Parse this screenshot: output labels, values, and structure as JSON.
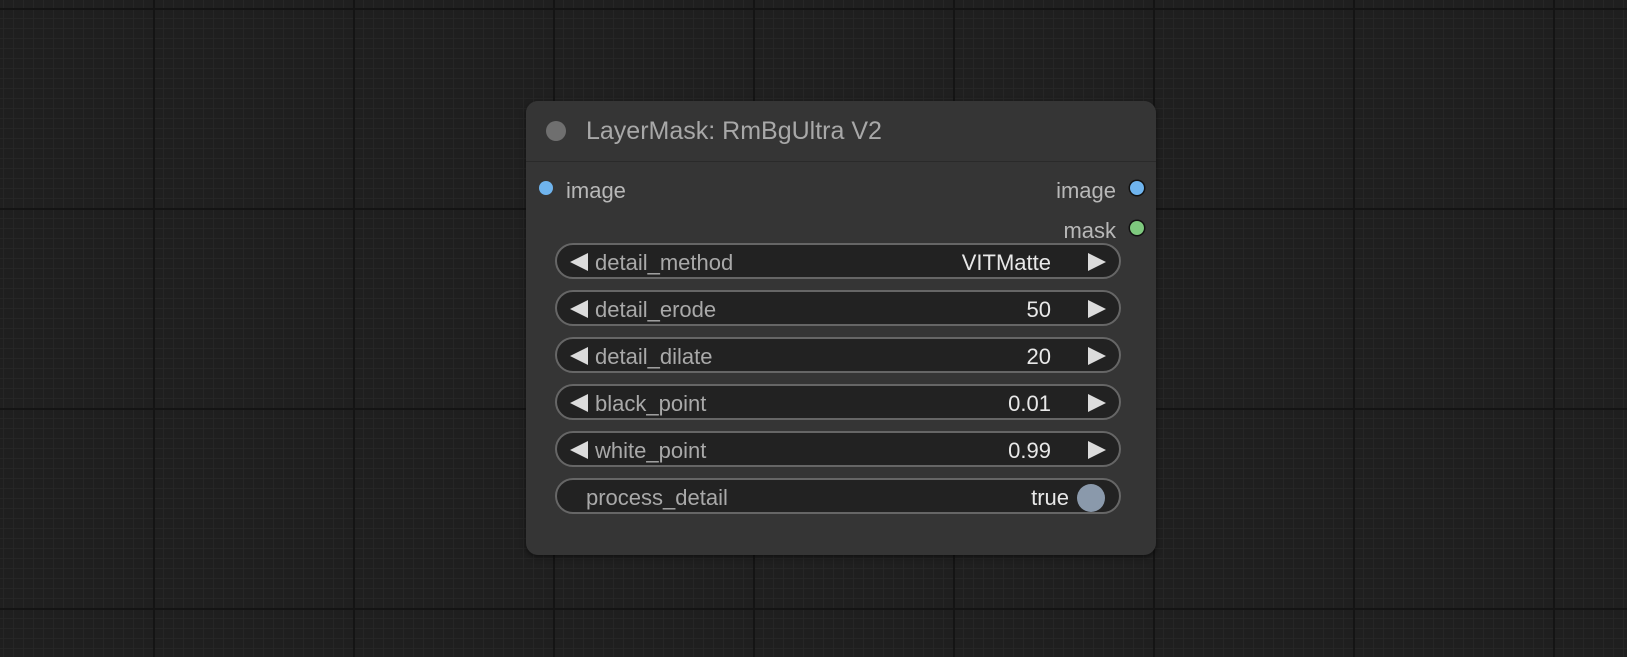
{
  "node": {
    "title": "LayerMask: RmBgUltra V2",
    "inputs": [
      {
        "label": "image",
        "color": "#6fb4ee"
      }
    ],
    "outputs": [
      {
        "label": "image",
        "color": "#6fb4ee"
      },
      {
        "label": "mask",
        "color": "#7ec97e"
      }
    ],
    "widgets": [
      {
        "label": "detail_method",
        "value": "VITMatte"
      },
      {
        "label": "detail_erode",
        "value": "50"
      },
      {
        "label": "detail_dilate",
        "value": "20"
      },
      {
        "label": "black_point",
        "value": "0.01"
      },
      {
        "label": "white_point",
        "value": "0.99"
      }
    ],
    "toggle": {
      "label": "process_detail",
      "value": "true"
    }
  },
  "colors": {
    "canvas_bg": "#1f1f1f",
    "node_bg": "#353535",
    "widget_bg": "#222222",
    "widget_border": "#666666",
    "toggle_knob": "#8a99ab"
  },
  "icons": {
    "collapse": "collapse-dot-icon",
    "decrement": "left-triangle-arrow-icon",
    "increment": "right-triangle-arrow-icon",
    "slot": "slot-dot-icon"
  }
}
